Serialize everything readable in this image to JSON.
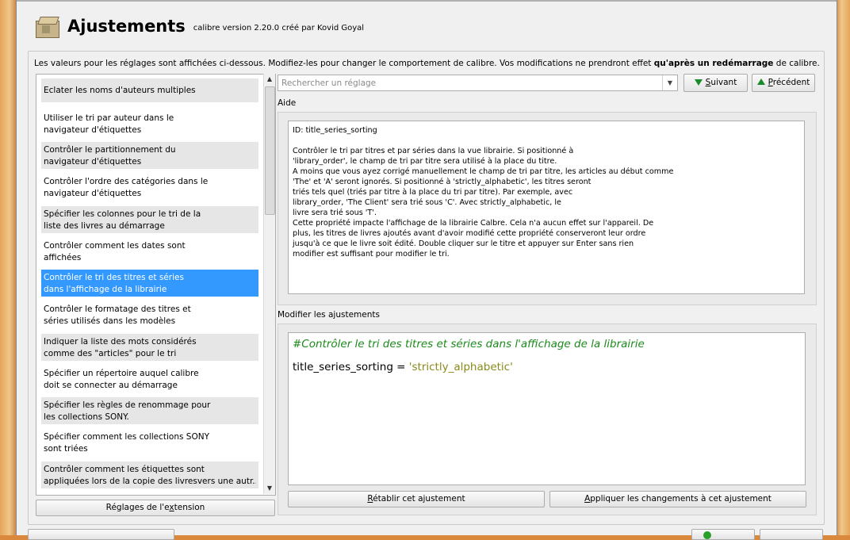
{
  "header": {
    "title": "Ajustements",
    "subtitle": "calibre version 2.20.0 créé par Kovid Goyal"
  },
  "info": {
    "text_before": "Les valeurs pour les réglages sont affichées ci-dessous. Modifiez-les pour changer le comportement de calibre. Vos modifications ne prendront effet ",
    "text_bold": "qu'après un redémarrage",
    "text_after": " de calibre."
  },
  "tweaks_list": {
    "items": [
      {
        "line1": "Eclater les noms d'auteurs multiples",
        "line2": ""
      },
      {
        "line1": "Utiliser le tri par auteur dans le",
        "line2": "navigateur d'étiquettes"
      },
      {
        "line1": "Contrôler le partitionnement du",
        "line2": "navigateur d'étiquettes"
      },
      {
        "line1": "Contrôler l'ordre des catégories dans le",
        "line2": "navigateur d'étiquettes"
      },
      {
        "line1": "Spécifier les colonnes pour le tri de la",
        "line2": "liste des livres au démarrage"
      },
      {
        "line1": "Contrôler comment les dates sont",
        "line2": "affichées"
      },
      {
        "line1": "Contrôler le tri des titres et séries",
        "line2": "dans l'affichage de la librairie"
      },
      {
        "line1": "Contrôler le formatage des titres et",
        "line2": "séries utilisés dans les modèles"
      },
      {
        "line1": "Indiquer la liste des mots considérés",
        "line2": "comme des \"articles\" pour le tri"
      },
      {
        "line1": "Spécifier un répertoire auquel calibre",
        "line2": "doit se connecter au démarrage"
      },
      {
        "line1": "Spécifier les règles de renommage pour",
        "line2": "les collections SONY."
      },
      {
        "line1": "Spécifier comment les collections SONY",
        "line2": "sont triées"
      },
      {
        "line1": "Contrôler comment les étiquettes sont",
        "line2": "appliquées lors de la copie des livresvers une autr..."
      }
    ],
    "selected_index": 6
  },
  "extension_button": {
    "before": "Réglages de l'e",
    "underlined": "x",
    "after": "tension"
  },
  "search": {
    "placeholder": "Rechercher un réglage",
    "value": ""
  },
  "next_button": {
    "underlined": "S",
    "rest": "uivant"
  },
  "prev_button": {
    "underlined": "P",
    "rest": "récédent"
  },
  "help": {
    "label": "Aide",
    "text": "ID: title_series_sorting\n\nContrôler le tri par titres et par séries dans la vue librairie. Si positionné à\n'library_order', le champ de tri par titre sera utilisé à la place du titre.\nA moins que vous ayez corrigé manuellement le champ de tri par titre, les articles au début comme\n'The' et 'A' seront ignorés. Si positionné à 'strictly_alphabetic', les titres seront\ntriés tels quel (triés par titre à la place du tri par titre). Par exemple, avec\nlibrary_order, 'The Client' sera trié sous 'C'. Avec strictly_alphabetic, le\nlivre sera trié sous 'T'.\nCette propriété impacte l'affichage de la librairie Calbre. Cela n'a aucun effet sur l'appareil. De\nplus, les titres de livres ajoutés avant d'avoir modifié cette propriété conserveront leur ordre\njusqu'à ce que le livre soit édité. Double cliquer sur le titre et appuyer sur Enter sans rien\nmodifier est suffisant pour modifier le tri."
  },
  "editor": {
    "label": "Modifier les ajustements",
    "comment": "#Contrôler le tri des titres et séries dans l'affichage de la librairie",
    "code_key": "title_series_sorting = ",
    "code_value": "'strictly_alphabetic'"
  },
  "reset_button": {
    "underlined": "R",
    "rest": "établir cet ajustement"
  },
  "apply_button": {
    "underlined": "A",
    "rest": "ppliquer les changements à cet ajustement"
  },
  "colors": {
    "selection": "#3399ff",
    "comment": "#1a8a1a",
    "string": "#8a8a1a",
    "arrow": "#1a8a2a"
  }
}
